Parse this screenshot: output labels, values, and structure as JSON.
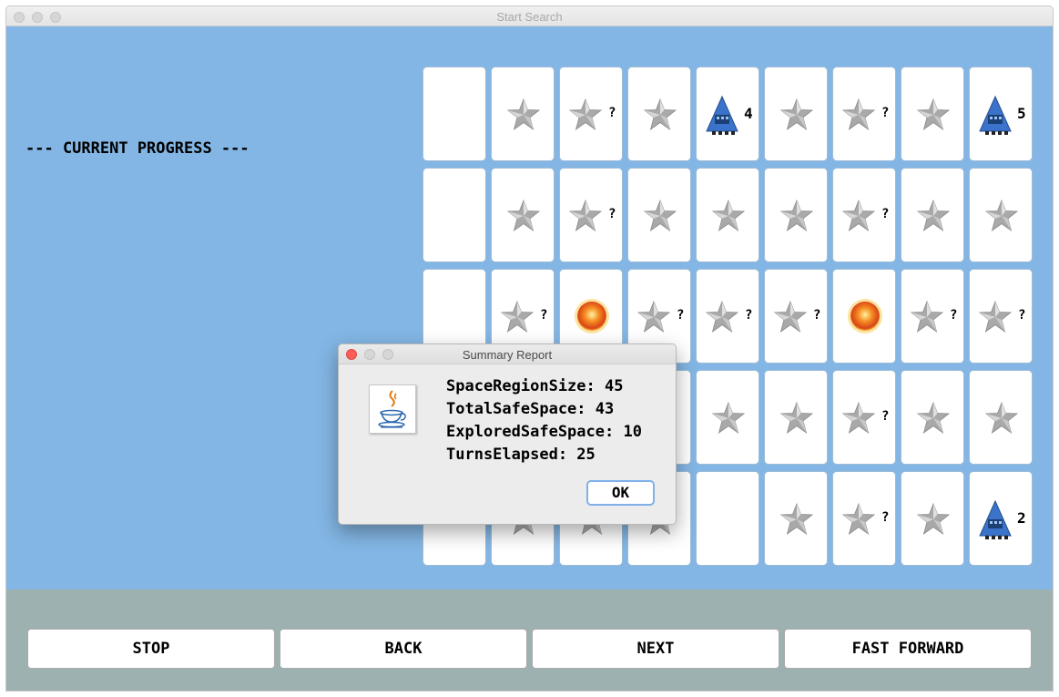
{
  "window": {
    "title": "Start Search"
  },
  "progress": {
    "label": "--- CURRENT PROGRESS ---"
  },
  "grid": {
    "rows": [
      [
        {
          "t": "empty"
        },
        {
          "t": "star"
        },
        {
          "t": "star",
          "m": "?"
        },
        {
          "t": "star"
        },
        {
          "t": "ship",
          "m": "4"
        },
        {
          "t": "star"
        },
        {
          "t": "star",
          "m": "?"
        },
        {
          "t": "star"
        },
        {
          "t": "ship",
          "m": "5"
        }
      ],
      [
        {
          "t": "empty"
        },
        {
          "t": "star"
        },
        {
          "t": "star",
          "m": "?"
        },
        {
          "t": "star"
        },
        {
          "t": "star"
        },
        {
          "t": "star"
        },
        {
          "t": "star",
          "m": "?"
        },
        {
          "t": "star"
        },
        {
          "t": "star"
        }
      ],
      [
        {
          "t": "empty"
        },
        {
          "t": "star",
          "m": "?"
        },
        {
          "t": "sun"
        },
        {
          "t": "star",
          "m": "?"
        },
        {
          "t": "star",
          "m": "?"
        },
        {
          "t": "star",
          "m": "?"
        },
        {
          "t": "sun"
        },
        {
          "t": "star",
          "m": "?"
        },
        {
          "t": "star",
          "m": "?"
        }
      ],
      [
        {
          "t": "empty"
        },
        {
          "t": "empty"
        },
        {
          "t": "empty"
        },
        {
          "t": "empty"
        },
        {
          "t": "star"
        },
        {
          "t": "star"
        },
        {
          "t": "star",
          "m": "?"
        },
        {
          "t": "star"
        },
        {
          "t": "star"
        }
      ],
      [
        {
          "t": "empty"
        },
        {
          "t": "star"
        },
        {
          "t": "star"
        },
        {
          "t": "star"
        },
        {
          "t": "empty"
        },
        {
          "t": "star"
        },
        {
          "t": "star",
          "m": "?"
        },
        {
          "t": "star"
        },
        {
          "t": "ship",
          "m": "2"
        }
      ]
    ]
  },
  "controls": {
    "stop": "STOP",
    "back": "BACK",
    "next": "NEXT",
    "fast_forward": "FAST FORWARD"
  },
  "dialog": {
    "title": "Summary Report",
    "lines": {
      "space_region_size": "SpaceRegionSize: 45",
      "total_safe_space": "TotalSafeSpace: 43",
      "explored_safe_space": "ExploredSafeSpace: 10",
      "turns_elapsed": "TurnsElapsed: 25"
    },
    "ok_label": "OK"
  },
  "icons": {
    "star": "silver-star-icon",
    "sun": "sun-icon",
    "ship": "spaceship-icon",
    "java": "java-cup-icon"
  },
  "colors": {
    "background": "#83b6e4",
    "bottom_panel": "#9db1b0",
    "ship_blue": "#3a73c9"
  }
}
